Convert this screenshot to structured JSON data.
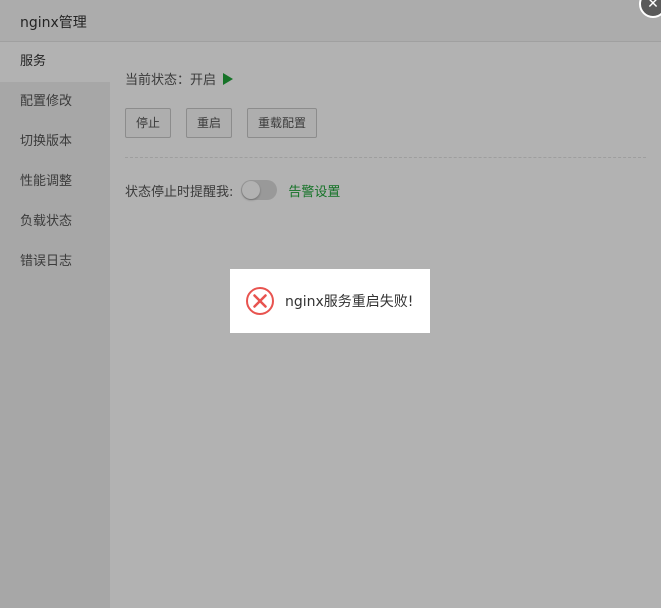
{
  "window": {
    "title": "nginx管理",
    "close_glyph": "✕"
  },
  "sidebar": {
    "items": [
      {
        "label": "服务",
        "active": true
      },
      {
        "label": "配置修改"
      },
      {
        "label": "切换版本"
      },
      {
        "label": "性能调整"
      },
      {
        "label": "负载状态"
      },
      {
        "label": "错误日志"
      }
    ]
  },
  "service": {
    "status_label": "当前状态：",
    "status_value": "开启",
    "status_icon": "play-icon",
    "buttons": {
      "stop": "停止",
      "restart": "重启",
      "reload": "重载配置"
    }
  },
  "alert": {
    "label": "状态停止时提醒我:",
    "toggle_on": false,
    "link": "告警设置"
  },
  "toast": {
    "icon": "error-circle-x-icon",
    "message": "nginx服务重启失败!"
  },
  "colors": {
    "accent": "#20a53a",
    "error": "#e8534f",
    "overlay": "rgba(0,0,0,0.3)"
  }
}
